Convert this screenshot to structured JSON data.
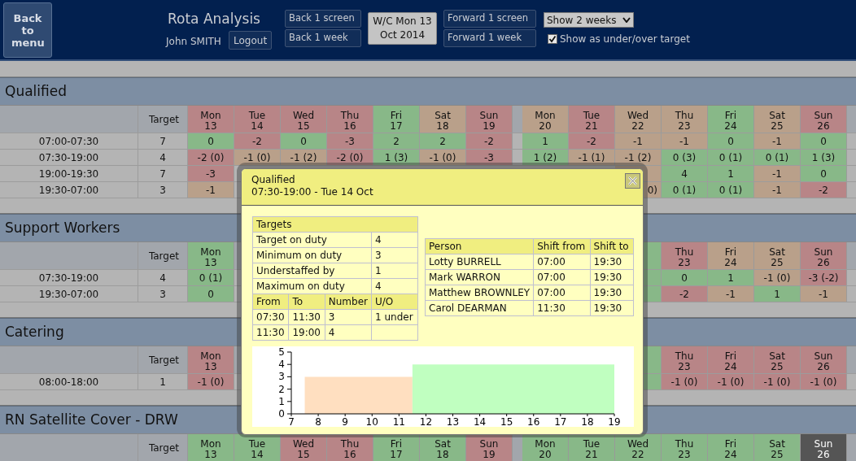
{
  "back_button": "Back to menu",
  "app_title": "Rota Analysis",
  "user_name": "John SMITH",
  "logout_button": "Logout",
  "back_buttons": [
    "Back 1 screen",
    "Back 1 week"
  ],
  "week_button": [
    "W/C Mon 13",
    "Oct 2014"
  ],
  "forward_buttons": [
    "Forward 1 screen",
    "Forward 1 week"
  ],
  "period_select": {
    "value": "Show 2 weeks"
  },
  "under_over_checkbox": {
    "label": "Show as under/over target",
    "checked": true
  },
  "sections": [
    {
      "title": "Qualified",
      "target_label": "Target",
      "days_week_1": [
        {
          "day": "Mon",
          "date": "13",
          "color": "#b88587"
        },
        {
          "day": "Tue",
          "date": "14",
          "color": "#b88587"
        },
        {
          "day": "Wed",
          "date": "15",
          "color": "#b88587"
        },
        {
          "day": "Thu",
          "date": "16",
          "color": "#b88587"
        },
        {
          "day": "Fri",
          "date": "17",
          "color": "#88b888"
        },
        {
          "day": "Sat",
          "date": "18",
          "color": "#b9a08a"
        },
        {
          "day": "Sun",
          "date": "19",
          "color": "#b88587"
        }
      ],
      "days_week_2": [
        {
          "day": "Mon",
          "date": "20",
          "color": "#b9a08a"
        },
        {
          "day": "Tue",
          "date": "21",
          "color": "#b88587"
        },
        {
          "day": "Wed",
          "date": "22",
          "color": "#b9a08a"
        },
        {
          "day": "Thu",
          "date": "23",
          "color": "#b9a08a"
        },
        {
          "day": "Fri",
          "date": "24",
          "color": "#88b888"
        },
        {
          "day": "Sat",
          "date": "25",
          "color": "#b9a08a"
        },
        {
          "day": "Sun",
          "date": "26",
          "color": "#b88587"
        }
      ],
      "rows": [
        {
          "time": "07:00-07:30",
          "target": "7",
          "week_1": [
            {
              "text": "0",
              "color": "#88b888"
            },
            {
              "text": "-2",
              "color": "#b88587"
            },
            {
              "text": "0",
              "color": "#88b888"
            },
            {
              "text": "-3",
              "color": "#b88587"
            },
            {
              "text": "2",
              "color": "#88b888"
            },
            {
              "text": "2",
              "color": "#88b888"
            },
            {
              "text": "-2",
              "color": "#b88587"
            }
          ],
          "week_2": [
            {
              "text": "1",
              "color": "#88b888"
            },
            {
              "text": "-2",
              "color": "#b88587"
            },
            {
              "text": "-1",
              "color": "#b9a08a"
            },
            {
              "text": "-1",
              "color": "#b9a08a"
            },
            {
              "text": "0",
              "color": "#88b888"
            },
            {
              "text": "-1",
              "color": "#b9a08a"
            },
            {
              "text": "0",
              "color": "#88b888"
            }
          ]
        },
        {
          "time": "07:30-19:00",
          "target": "4",
          "week_1": [
            {
              "text": "-2 (0)",
              "color": "#b88587"
            },
            {
              "text": "-1 (0)",
              "color": "#b9a08a"
            },
            {
              "text": "-1 (2)",
              "color": "#b9a08a"
            },
            {
              "text": "-2 (0)",
              "color": "#b88587"
            },
            {
              "text": "1 (3)",
              "color": "#88b888"
            },
            {
              "text": "-1 (0)",
              "color": "#b9a08a"
            },
            {
              "text": "-3",
              "color": "#b88587"
            }
          ],
          "week_2": [
            {
              "text": "1 (2)",
              "color": "#88b888"
            },
            {
              "text": "-1 (1)",
              "color": "#b9a08a"
            },
            {
              "text": "-1 (2)",
              "color": "#b9a08a"
            },
            {
              "text": "0 (3)",
              "color": "#88b888"
            },
            {
              "text": "0 (1)",
              "color": "#88b888"
            },
            {
              "text": "0 (1)",
              "color": "#88b888"
            },
            {
              "text": "1 (3)",
              "color": "#88b888"
            }
          ]
        },
        {
          "time": "19:00-19:30",
          "target": "7",
          "week_1": [
            {
              "text": "-3",
              "color": "#b88587"
            }
          ],
          "week_2": [
            {
              "color": "#b9a08a"
            },
            {
              "text": "4",
              "color": "#88b888"
            },
            {
              "text": "1",
              "color": "#88b888"
            },
            {
              "text": "-1",
              "color": "#b9a08a"
            },
            {
              "text": "0",
              "color": "#88b888"
            }
          ]
        },
        {
          "time": "19:30-07:00",
          "target": "3",
          "week_1": [
            {
              "text": "-1",
              "color": "#b9a08a"
            }
          ],
          "week_2": [
            {
              "text": "0)",
              "color": "#b9a08a",
              "clipped": true
            },
            {
              "text": "0 (1)",
              "color": "#88b888"
            },
            {
              "text": "0 (1)",
              "color": "#88b888"
            },
            {
              "text": "-1",
              "color": "#b9a08a"
            },
            {
              "text": "-2",
              "color": "#b88587"
            }
          ]
        }
      ]
    },
    {
      "title": "Support Workers",
      "target_label": "Target",
      "days_week_1": [
        {
          "day": "Mon",
          "date": "13",
          "color": "#88b888"
        }
      ],
      "days_week_2": [
        {
          "color": "#88b888"
        },
        {
          "day": "Thu",
          "date": "23",
          "color": "#b88587"
        },
        {
          "day": "Fri",
          "date": "24",
          "color": "#b9a08a"
        },
        {
          "day": "Sat",
          "date": "25",
          "color": "#b9a08a"
        },
        {
          "day": "Sun",
          "date": "26",
          "color": "#b88587"
        }
      ],
      "rows": [
        {
          "time": "07:30-19:00",
          "target": "4",
          "week_1": [
            {
              "text": "0 (1)",
              "color": "#88b888"
            }
          ],
          "week_2": [
            {
              "color": "#88b888"
            },
            {
              "text": "0",
              "color": "#88b888"
            },
            {
              "text": "1",
              "color": "#88b888"
            },
            {
              "text": "-1 (0)",
              "color": "#b9a08a"
            },
            {
              "text": "-3 (-2)",
              "color": "#b88587"
            }
          ]
        },
        {
          "time": "19:30-07:00",
          "target": "3",
          "week_1": [
            {
              "text": "0",
              "color": "#88b888"
            }
          ],
          "week_2": [
            {
              "color": "#88b888"
            },
            {
              "text": "-2",
              "color": "#b88587"
            },
            {
              "text": "-1",
              "color": "#b9a08a"
            },
            {
              "text": "1",
              "color": "#88b888"
            },
            {
              "text": "-1",
              "color": "#b9a08a"
            }
          ]
        }
      ]
    },
    {
      "title": "Catering",
      "target_label": "Target",
      "days_week_1": [
        {
          "day": "Mon",
          "date": "13",
          "color": "#b88587"
        }
      ],
      "days_week_2": [
        {
          "color": "#88b888"
        },
        {
          "day": "Thu",
          "date": "23",
          "color": "#b88587"
        },
        {
          "day": "Fri",
          "date": "24",
          "color": "#b88587"
        },
        {
          "day": "Sat",
          "date": "25",
          "color": "#b88587"
        },
        {
          "day": "Sun",
          "date": "26",
          "color": "#b88587"
        }
      ],
      "rows": [
        {
          "time": "08:00-18:00",
          "target": "1",
          "week_1": [
            {
              "text": "-1 (0)",
              "color": "#b88587"
            }
          ],
          "week_2": [
            {
              "color": "#88b888"
            },
            {
              "text": "-1 (0)",
              "color": "#b88587"
            },
            {
              "text": "-1 (0)",
              "color": "#b88587"
            },
            {
              "text": "-1 (0)",
              "color": "#b88587"
            },
            {
              "text": "-1 (0)",
              "color": "#b88587"
            }
          ]
        }
      ]
    },
    {
      "title": "RN Satellite Cover - DRW",
      "target_label": "Target",
      "days_week_1": [
        {
          "day": "Mon",
          "date": "13",
          "color": "#88b888"
        },
        {
          "day": "Tue",
          "date": "14",
          "color": "#88b888"
        },
        {
          "day": "Wed",
          "date": "15",
          "color": "#b88587"
        },
        {
          "day": "Thu",
          "date": "16",
          "color": "#b88587"
        },
        {
          "day": "Fri",
          "date": "17",
          "color": "#88b888"
        },
        {
          "day": "Sat",
          "date": "18",
          "color": "#88b888"
        },
        {
          "day": "Sun",
          "date": "19",
          "color": "#b88587"
        }
      ],
      "days_week_2": [
        {
          "day": "Mon",
          "date": "20",
          "color": "#88b888"
        },
        {
          "day": "Tue",
          "date": "21",
          "color": "#88b888"
        },
        {
          "day": "Wed",
          "date": "22",
          "color": "#88b888"
        },
        {
          "day": "Thu",
          "date": "23",
          "color": "#88b888"
        },
        {
          "day": "Fri",
          "date": "24",
          "color": "#88b888"
        },
        {
          "day": "Sat",
          "date": "25",
          "color": "#88b888"
        },
        {
          "day": "Sun",
          "date": "26",
          "color": "#555555"
        }
      ]
    }
  ],
  "popup": {
    "title": "Qualified",
    "subtitle": "07:30-19:00 - Tue 14 Oct",
    "targets": {
      "heading": "Targets",
      "items": [
        {
          "label": "Target on duty",
          "value": "4"
        },
        {
          "label": "Minimum on duty",
          "value": "3"
        },
        {
          "label": "Understaffed by",
          "value": "1"
        },
        {
          "label": "Maximum on duty",
          "value": "4"
        }
      ],
      "columns": [
        "From",
        "To",
        "Number",
        "U/O"
      ],
      "rows": [
        {
          "from": "07:30",
          "to": "11:30",
          "number": "3",
          "uo": "1 under"
        },
        {
          "from": "11:30",
          "to": "19:00",
          "number": "4"
        }
      ]
    },
    "people": {
      "columns": [
        "Person",
        "Shift from",
        "Shift to"
      ],
      "rows": [
        [
          "Lotty BURRELL",
          "07:00",
          "19:30"
        ],
        [
          "Mark WARRON",
          "07:00",
          "19:30"
        ],
        [
          "Matthew BROWNLEY",
          "07:00",
          "19:30"
        ],
        [
          "Carol DEARMAN",
          "11:30",
          "19:30"
        ]
      ]
    },
    "chart_data": {
      "type": "area",
      "x": [
        7.5,
        11.5,
        19
      ],
      "series": [
        {
          "color": "#ffdfc0",
          "values": [
            3,
            3,
            null
          ]
        },
        {
          "color": "#c0ffc0",
          "values": [
            null,
            4,
            4
          ]
        }
      ],
      "xlim": [
        7,
        19
      ],
      "ylim": [
        0,
        5
      ],
      "xticks": [
        7,
        8,
        9,
        10,
        11,
        12,
        13,
        14,
        15,
        16,
        17,
        18,
        19
      ],
      "yticks": [
        0,
        1,
        2,
        3,
        4,
        5
      ]
    }
  }
}
